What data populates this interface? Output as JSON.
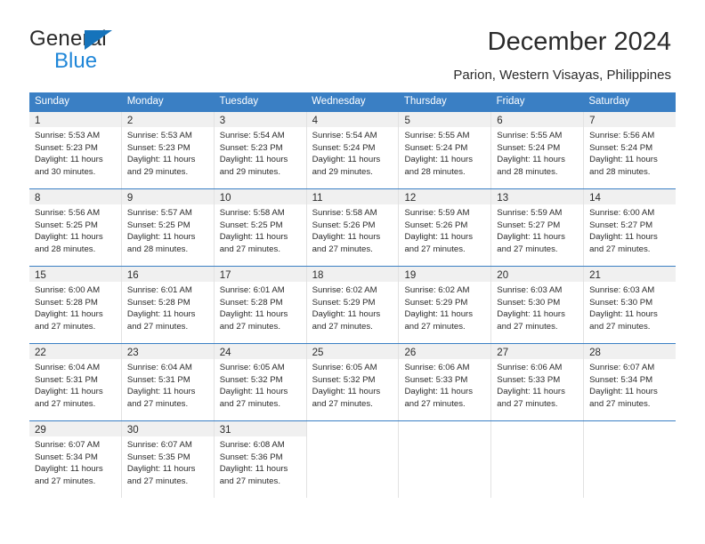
{
  "logo": {
    "word_one": "General",
    "word_two": "Blue",
    "triangle_color": "#1573bb",
    "blue_color": "#1f86d8"
  },
  "header": {
    "title": "December 2024",
    "subtitle": "Parion, Western Visayas, Philippines"
  },
  "theme": {
    "header_blue": "#3a7fc4",
    "day_band_gray": "#f0f0f0",
    "cell_divider": "#e2e2e2",
    "text": "#2b2b2b"
  },
  "weekdays": [
    "Sunday",
    "Monday",
    "Tuesday",
    "Wednesday",
    "Thursday",
    "Friday",
    "Saturday"
  ],
  "weeks": [
    [
      {
        "day": "1",
        "sunrise": "Sunrise: 5:53 AM",
        "sunset": "Sunset: 5:23 PM",
        "daylight": "Daylight: 11 hours and 30 minutes."
      },
      {
        "day": "2",
        "sunrise": "Sunrise: 5:53 AM",
        "sunset": "Sunset: 5:23 PM",
        "daylight": "Daylight: 11 hours and 29 minutes."
      },
      {
        "day": "3",
        "sunrise": "Sunrise: 5:54 AM",
        "sunset": "Sunset: 5:23 PM",
        "daylight": "Daylight: 11 hours and 29 minutes."
      },
      {
        "day": "4",
        "sunrise": "Sunrise: 5:54 AM",
        "sunset": "Sunset: 5:24 PM",
        "daylight": "Daylight: 11 hours and 29 minutes."
      },
      {
        "day": "5",
        "sunrise": "Sunrise: 5:55 AM",
        "sunset": "Sunset: 5:24 PM",
        "daylight": "Daylight: 11 hours and 28 minutes."
      },
      {
        "day": "6",
        "sunrise": "Sunrise: 5:55 AM",
        "sunset": "Sunset: 5:24 PM",
        "daylight": "Daylight: 11 hours and 28 minutes."
      },
      {
        "day": "7",
        "sunrise": "Sunrise: 5:56 AM",
        "sunset": "Sunset: 5:24 PM",
        "daylight": "Daylight: 11 hours and 28 minutes."
      }
    ],
    [
      {
        "day": "8",
        "sunrise": "Sunrise: 5:56 AM",
        "sunset": "Sunset: 5:25 PM",
        "daylight": "Daylight: 11 hours and 28 minutes."
      },
      {
        "day": "9",
        "sunrise": "Sunrise: 5:57 AM",
        "sunset": "Sunset: 5:25 PM",
        "daylight": "Daylight: 11 hours and 28 minutes."
      },
      {
        "day": "10",
        "sunrise": "Sunrise: 5:58 AM",
        "sunset": "Sunset: 5:25 PM",
        "daylight": "Daylight: 11 hours and 27 minutes."
      },
      {
        "day": "11",
        "sunrise": "Sunrise: 5:58 AM",
        "sunset": "Sunset: 5:26 PM",
        "daylight": "Daylight: 11 hours and 27 minutes."
      },
      {
        "day": "12",
        "sunrise": "Sunrise: 5:59 AM",
        "sunset": "Sunset: 5:26 PM",
        "daylight": "Daylight: 11 hours and 27 minutes."
      },
      {
        "day": "13",
        "sunrise": "Sunrise: 5:59 AM",
        "sunset": "Sunset: 5:27 PM",
        "daylight": "Daylight: 11 hours and 27 minutes."
      },
      {
        "day": "14",
        "sunrise": "Sunrise: 6:00 AM",
        "sunset": "Sunset: 5:27 PM",
        "daylight": "Daylight: 11 hours and 27 minutes."
      }
    ],
    [
      {
        "day": "15",
        "sunrise": "Sunrise: 6:00 AM",
        "sunset": "Sunset: 5:28 PM",
        "daylight": "Daylight: 11 hours and 27 minutes."
      },
      {
        "day": "16",
        "sunrise": "Sunrise: 6:01 AM",
        "sunset": "Sunset: 5:28 PM",
        "daylight": "Daylight: 11 hours and 27 minutes."
      },
      {
        "day": "17",
        "sunrise": "Sunrise: 6:01 AM",
        "sunset": "Sunset: 5:28 PM",
        "daylight": "Daylight: 11 hours and 27 minutes."
      },
      {
        "day": "18",
        "sunrise": "Sunrise: 6:02 AM",
        "sunset": "Sunset: 5:29 PM",
        "daylight": "Daylight: 11 hours and 27 minutes."
      },
      {
        "day": "19",
        "sunrise": "Sunrise: 6:02 AM",
        "sunset": "Sunset: 5:29 PM",
        "daylight": "Daylight: 11 hours and 27 minutes."
      },
      {
        "day": "20",
        "sunrise": "Sunrise: 6:03 AM",
        "sunset": "Sunset: 5:30 PM",
        "daylight": "Daylight: 11 hours and 27 minutes."
      },
      {
        "day": "21",
        "sunrise": "Sunrise: 6:03 AM",
        "sunset": "Sunset: 5:30 PM",
        "daylight": "Daylight: 11 hours and 27 minutes."
      }
    ],
    [
      {
        "day": "22",
        "sunrise": "Sunrise: 6:04 AM",
        "sunset": "Sunset: 5:31 PM",
        "daylight": "Daylight: 11 hours and 27 minutes."
      },
      {
        "day": "23",
        "sunrise": "Sunrise: 6:04 AM",
        "sunset": "Sunset: 5:31 PM",
        "daylight": "Daylight: 11 hours and 27 minutes."
      },
      {
        "day": "24",
        "sunrise": "Sunrise: 6:05 AM",
        "sunset": "Sunset: 5:32 PM",
        "daylight": "Daylight: 11 hours and 27 minutes."
      },
      {
        "day": "25",
        "sunrise": "Sunrise: 6:05 AM",
        "sunset": "Sunset: 5:32 PM",
        "daylight": "Daylight: 11 hours and 27 minutes."
      },
      {
        "day": "26",
        "sunrise": "Sunrise: 6:06 AM",
        "sunset": "Sunset: 5:33 PM",
        "daylight": "Daylight: 11 hours and 27 minutes."
      },
      {
        "day": "27",
        "sunrise": "Sunrise: 6:06 AM",
        "sunset": "Sunset: 5:33 PM",
        "daylight": "Daylight: 11 hours and 27 minutes."
      },
      {
        "day": "28",
        "sunrise": "Sunrise: 6:07 AM",
        "sunset": "Sunset: 5:34 PM",
        "daylight": "Daylight: 11 hours and 27 minutes."
      }
    ],
    [
      {
        "day": "29",
        "sunrise": "Sunrise: 6:07 AM",
        "sunset": "Sunset: 5:34 PM",
        "daylight": "Daylight: 11 hours and 27 minutes."
      },
      {
        "day": "30",
        "sunrise": "Sunrise: 6:07 AM",
        "sunset": "Sunset: 5:35 PM",
        "daylight": "Daylight: 11 hours and 27 minutes."
      },
      {
        "day": "31",
        "sunrise": "Sunrise: 6:08 AM",
        "sunset": "Sunset: 5:36 PM",
        "daylight": "Daylight: 11 hours and 27 minutes."
      },
      {
        "day": "",
        "sunrise": "",
        "sunset": "",
        "daylight": ""
      },
      {
        "day": "",
        "sunrise": "",
        "sunset": "",
        "daylight": ""
      },
      {
        "day": "",
        "sunrise": "",
        "sunset": "",
        "daylight": ""
      },
      {
        "day": "",
        "sunrise": "",
        "sunset": "",
        "daylight": ""
      }
    ]
  ]
}
